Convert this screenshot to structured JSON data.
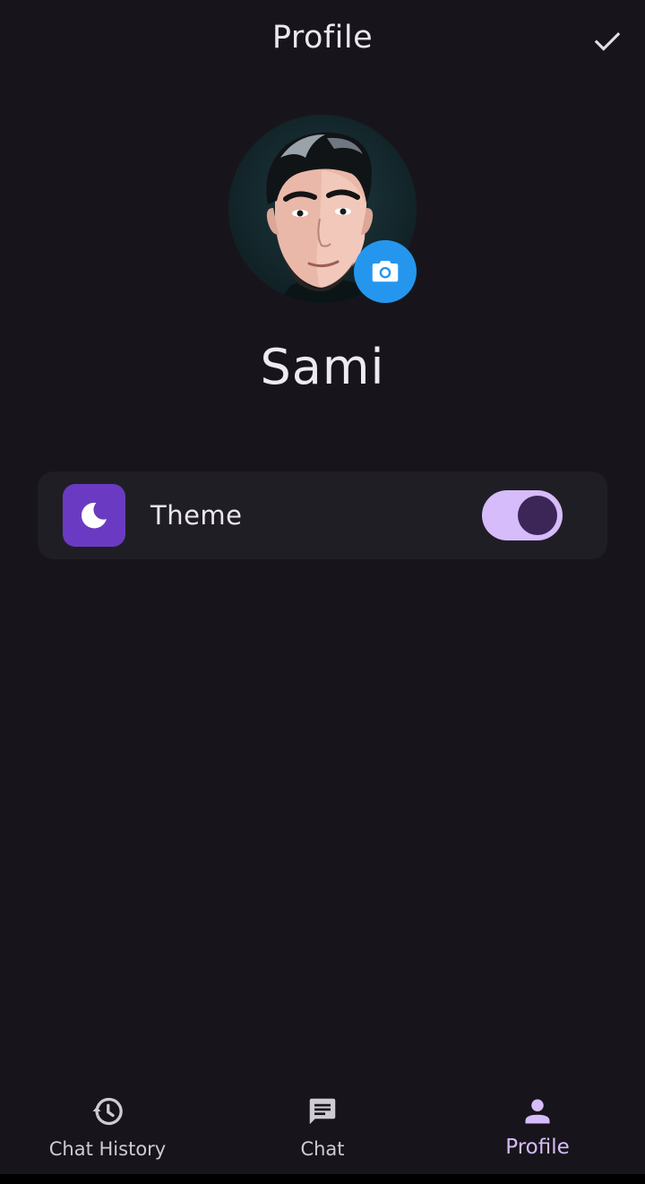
{
  "app_bar": {
    "title": "Profile",
    "confirm_icon": "check-icon"
  },
  "profile": {
    "avatar_icon": "cartoon-avatar-portrait",
    "camera_icon": "camera-icon",
    "name": "Sami"
  },
  "settings": {
    "theme": {
      "icon": "moon-icon",
      "label": "Theme",
      "enabled": true
    }
  },
  "bottom_nav": {
    "items": [
      {
        "label": "Chat History",
        "icon": "history-icon",
        "active": false
      },
      {
        "label": "Chat",
        "icon": "chat-icon",
        "active": false
      },
      {
        "label": "Profile",
        "icon": "person-icon",
        "active": true
      }
    ]
  },
  "colors": {
    "background": "#17151b",
    "card": "#201e25",
    "accent": "#d6bcfa",
    "theme_icon_bg": "#6a3bc2",
    "camera_button": "#2596ee"
  }
}
